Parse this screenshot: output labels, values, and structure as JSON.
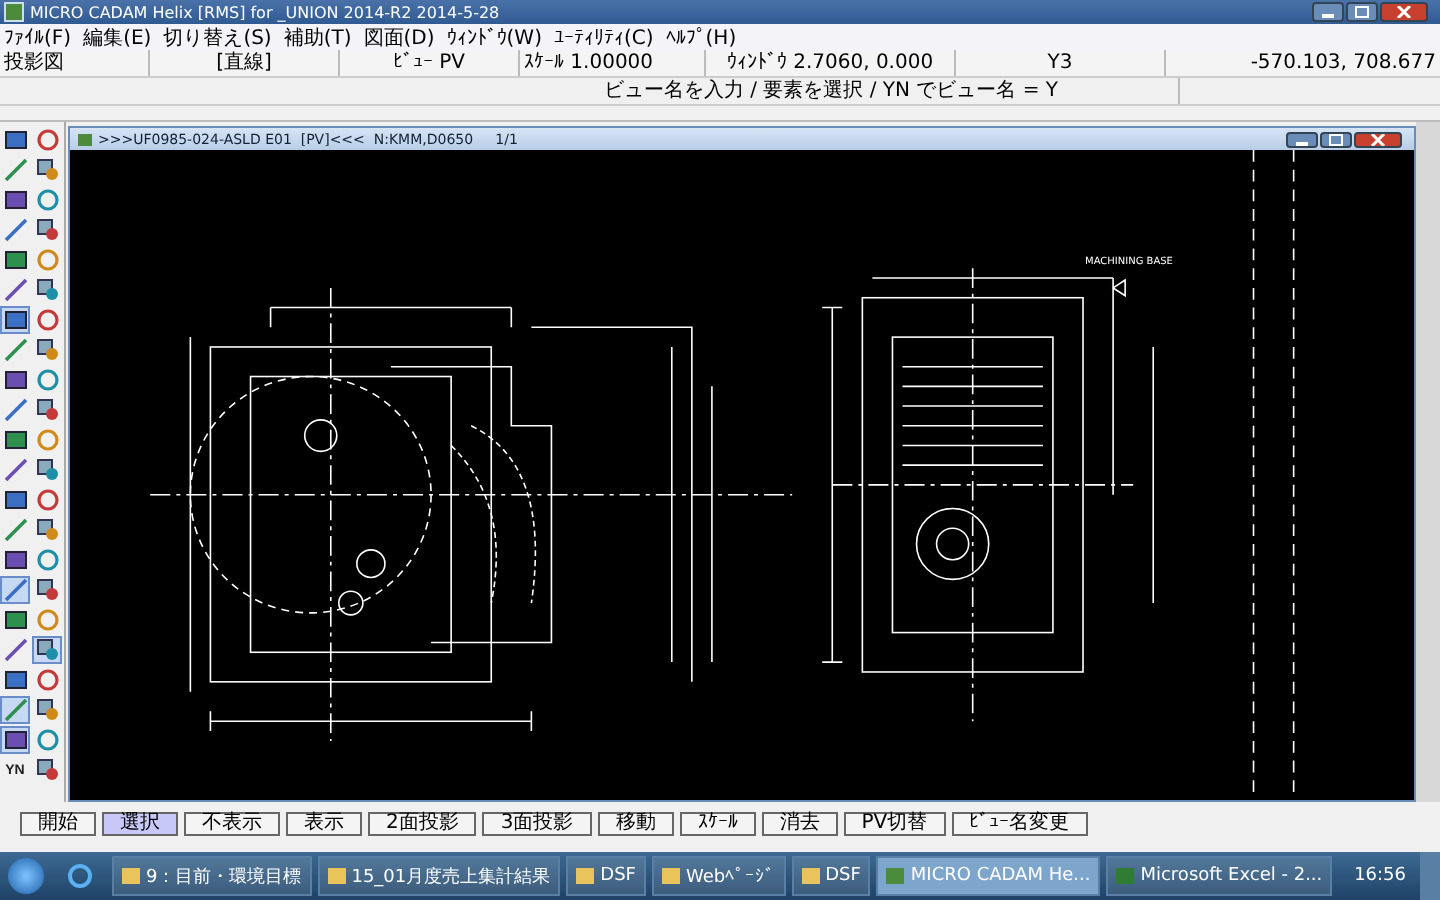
{
  "window": {
    "title": "MICRO CADAM Helix [RMS] for _UNION 2014-R2 2014-5-28"
  },
  "menu": [
    "ﾌｧｲﾙ(F)",
    "編集(E)",
    "切り替え(S)",
    "補助(T)",
    "図面(D)",
    "ｳｨﾝﾄﾞｳ(W)",
    "ﾕｰﾃｨﾘﾃｨ(C)",
    "ﾍﾙﾌﾟ(H)"
  ],
  "status_bar": [
    "投影図",
    "[直線]",
    "ﾋﾞｭｰ PV",
    "ｽｹｰﾙ 1.00000",
    "ｳｨﾝﾄﾞｳ 2.7060, 0.000",
    "Y3",
    "-570.103, 708.677"
  ],
  "prompt": "ビュー名を入力 / 要素を選択 / YN でビュー名 = Y",
  "toolbar": {
    "tools": [
      {
        "kind": "icon",
        "selected": false
      },
      {
        "kind": "icon",
        "selected": false
      },
      {
        "kind": "icon",
        "selected": false
      },
      {
        "kind": "icon",
        "selected": false
      },
      {
        "kind": "icon",
        "selected": false
      },
      {
        "kind": "icon",
        "selected": false
      },
      {
        "kind": "icon",
        "selected": false
      },
      {
        "kind": "icon",
        "selected": false
      },
      {
        "kind": "icon",
        "selected": false
      },
      {
        "kind": "icon",
        "selected": false
      },
      {
        "kind": "icon",
        "selected": false
      },
      {
        "kind": "icon",
        "selected": false
      },
      {
        "kind": "icon",
        "selected": true
      },
      {
        "kind": "icon",
        "selected": false
      },
      {
        "kind": "icon",
        "selected": false
      },
      {
        "kind": "icon",
        "selected": false
      },
      {
        "kind": "icon",
        "selected": false
      },
      {
        "kind": "icon",
        "selected": false
      },
      {
        "kind": "icon",
        "selected": false
      },
      {
        "kind": "icon",
        "selected": false
      },
      {
        "kind": "icon",
        "selected": false
      },
      {
        "kind": "icon",
        "selected": false
      },
      {
        "kind": "icon",
        "selected": false
      },
      {
        "kind": "icon",
        "selected": false
      },
      {
        "kind": "icon",
        "selected": false
      },
      {
        "kind": "icon",
        "selected": false
      },
      {
        "kind": "icon",
        "selected": false
      },
      {
        "kind": "icon",
        "selected": false
      },
      {
        "kind": "icon",
        "selected": false
      },
      {
        "kind": "icon",
        "selected": false
      },
      {
        "kind": "icon",
        "selected": true
      },
      {
        "kind": "icon",
        "selected": false
      },
      {
        "kind": "icon",
        "selected": false
      },
      {
        "kind": "icon",
        "selected": false
      },
      {
        "kind": "icon",
        "selected": false
      },
      {
        "kind": "icon",
        "selected": true
      },
      {
        "kind": "icon",
        "selected": false
      },
      {
        "kind": "icon",
        "selected": false
      },
      {
        "kind": "icon",
        "selected": true
      },
      {
        "kind": "icon",
        "selected": false
      },
      {
        "kind": "icon",
        "selected": true
      },
      {
        "kind": "icon",
        "selected": false
      },
      {
        "kind": "text",
        "label": "YN",
        "selected": false
      },
      {
        "kind": "icon",
        "selected": false
      }
    ]
  },
  "drawing_window": {
    "title": ">>>UF0985-024-ASLD E01  [PV]<<<  N:KMM,D0650     1/1",
    "annotation": "MACHINING BASE"
  },
  "commands": [
    {
      "label": "開始",
      "selected": false
    },
    {
      "label": "選択",
      "selected": true
    },
    {
      "label": "不表示",
      "selected": false
    },
    {
      "label": "表示",
      "selected": false
    },
    {
      "label": "2面投影",
      "selected": false
    },
    {
      "label": "3面投影",
      "selected": false
    },
    {
      "label": "移動",
      "selected": false
    },
    {
      "label": "ｽｹｰﾙ",
      "selected": false
    },
    {
      "label": "消去",
      "selected": false
    },
    {
      "label": "PV切替",
      "selected": false
    },
    {
      "label": "ﾋﾞｭｰ名変更",
      "selected": false
    }
  ],
  "taskbar": {
    "tasks": [
      {
        "label": "9：目前・環境目標",
        "kind": "folder",
        "selected": false
      },
      {
        "label": "15_01月度売上集計結果",
        "kind": "folder",
        "selected": false
      },
      {
        "label": "DSF",
        "kind": "folder",
        "selected": false
      },
      {
        "label": "Webﾍﾟｰｼﾞ",
        "kind": "folder",
        "selected": false
      },
      {
        "label": "DSF",
        "kind": "folder",
        "selected": false
      },
      {
        "label": "MICRO CADAM He...",
        "kind": "app",
        "selected": true
      },
      {
        "label": "Microsoft Excel - 2...",
        "kind": "excel",
        "selected": false
      }
    ],
    "clock": "16:56"
  }
}
